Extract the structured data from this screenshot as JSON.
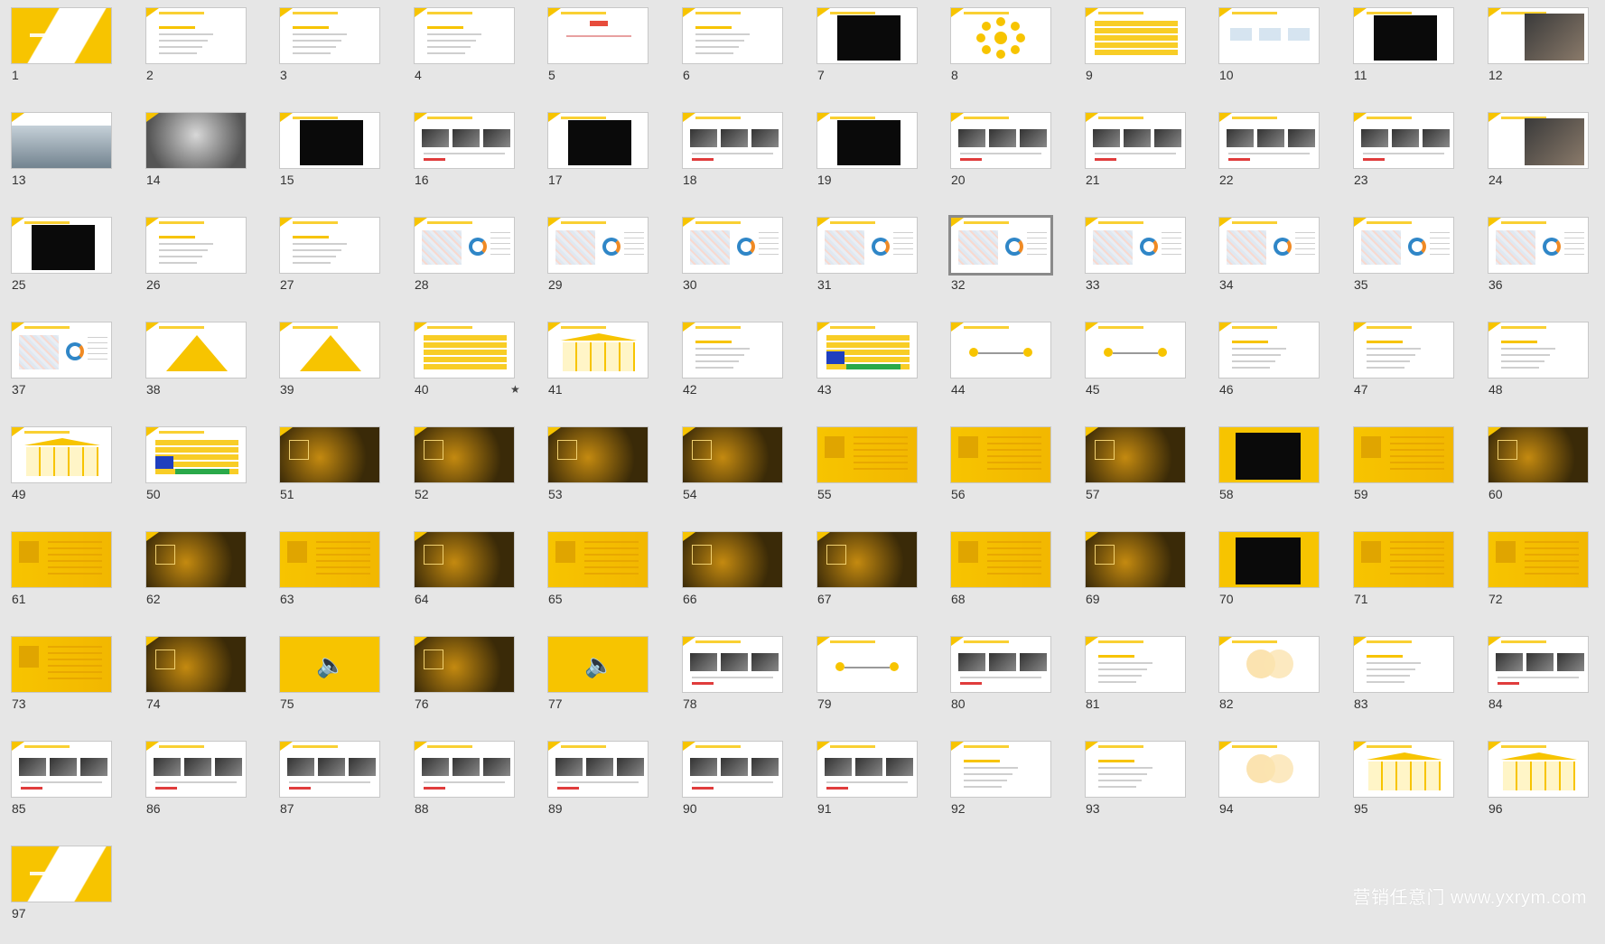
{
  "watermark": "营销任意门 www.yxrym.com",
  "selected_slide": 32,
  "colors": {
    "background": "#e6e6e6",
    "accent": "#f7c400",
    "border": "#c8c8c8"
  },
  "slides": [
    {
      "n": "1",
      "t": "title"
    },
    {
      "n": "2",
      "t": "text"
    },
    {
      "n": "3",
      "t": "text"
    },
    {
      "n": "4",
      "t": "text"
    },
    {
      "n": "5",
      "t": "diagram"
    },
    {
      "n": "6",
      "t": "text"
    },
    {
      "n": "7",
      "t": "video"
    },
    {
      "n": "8",
      "t": "circles"
    },
    {
      "n": "9",
      "t": "table"
    },
    {
      "n": "10",
      "t": "logos"
    },
    {
      "n": "11",
      "t": "video"
    },
    {
      "n": "12",
      "t": "photo"
    },
    {
      "n": "13",
      "t": "sky"
    },
    {
      "n": "14",
      "t": "cloud"
    },
    {
      "n": "15",
      "t": "video"
    },
    {
      "n": "16",
      "t": "mixed"
    },
    {
      "n": "17",
      "t": "video"
    },
    {
      "n": "18",
      "t": "mixed"
    },
    {
      "n": "19",
      "t": "video"
    },
    {
      "n": "20",
      "t": "mixed"
    },
    {
      "n": "21",
      "t": "mixed"
    },
    {
      "n": "22",
      "t": "mixed"
    },
    {
      "n": "23",
      "t": "mixed"
    },
    {
      "n": "24",
      "t": "photo"
    },
    {
      "n": "25",
      "t": "video"
    },
    {
      "n": "26",
      "t": "text"
    },
    {
      "n": "27",
      "t": "text"
    },
    {
      "n": "28",
      "t": "map"
    },
    {
      "n": "29",
      "t": "map"
    },
    {
      "n": "30",
      "t": "map"
    },
    {
      "n": "31",
      "t": "map"
    },
    {
      "n": "32",
      "t": "map"
    },
    {
      "n": "33",
      "t": "map"
    },
    {
      "n": "34",
      "t": "map"
    },
    {
      "n": "35",
      "t": "map"
    },
    {
      "n": "36",
      "t": "map"
    },
    {
      "n": "37",
      "t": "map"
    },
    {
      "n": "38",
      "t": "pyramid"
    },
    {
      "n": "39",
      "t": "pyramid"
    },
    {
      "n": "40",
      "t": "table",
      "star": "★"
    },
    {
      "n": "41",
      "t": "house"
    },
    {
      "n": "42",
      "t": "text"
    },
    {
      "n": "43",
      "t": "grid"
    },
    {
      "n": "44",
      "t": "flow"
    },
    {
      "n": "45",
      "t": "flow"
    },
    {
      "n": "46",
      "t": "text"
    },
    {
      "n": "47",
      "t": "text"
    },
    {
      "n": "48",
      "t": "text"
    },
    {
      "n": "49",
      "t": "house"
    },
    {
      "n": "50",
      "t": "grid"
    },
    {
      "n": "51",
      "t": "dark"
    },
    {
      "n": "52",
      "t": "dark"
    },
    {
      "n": "53",
      "t": "dark"
    },
    {
      "n": "54",
      "t": "dark"
    },
    {
      "n": "55",
      "t": "yellow"
    },
    {
      "n": "56",
      "t": "yellow"
    },
    {
      "n": "57",
      "t": "dark"
    },
    {
      "n": "58",
      "t": "yellowvideo"
    },
    {
      "n": "59",
      "t": "yellow"
    },
    {
      "n": "60",
      "t": "dark"
    },
    {
      "n": "61",
      "t": "yellow"
    },
    {
      "n": "62",
      "t": "dark"
    },
    {
      "n": "63",
      "t": "yellow"
    },
    {
      "n": "64",
      "t": "dark"
    },
    {
      "n": "65",
      "t": "yellow"
    },
    {
      "n": "66",
      "t": "dark"
    },
    {
      "n": "67",
      "t": "dark"
    },
    {
      "n": "68",
      "t": "yellow"
    },
    {
      "n": "69",
      "t": "dark"
    },
    {
      "n": "70",
      "t": "yellowvideo"
    },
    {
      "n": "71",
      "t": "yellow"
    },
    {
      "n": "72",
      "t": "yellow"
    },
    {
      "n": "73",
      "t": "yellow"
    },
    {
      "n": "74",
      "t": "dark"
    },
    {
      "n": "75",
      "t": "audio"
    },
    {
      "n": "76",
      "t": "dark"
    },
    {
      "n": "77",
      "t": "audio"
    },
    {
      "n": "78",
      "t": "mixed"
    },
    {
      "n": "79",
      "t": "flow"
    },
    {
      "n": "80",
      "t": "mixed"
    },
    {
      "n": "81",
      "t": "text"
    },
    {
      "n": "82",
      "t": "venn"
    },
    {
      "n": "83",
      "t": "text"
    },
    {
      "n": "84",
      "t": "mixed"
    },
    {
      "n": "85",
      "t": "mixed"
    },
    {
      "n": "86",
      "t": "mixed"
    },
    {
      "n": "87",
      "t": "mixed"
    },
    {
      "n": "88",
      "t": "mixed"
    },
    {
      "n": "89",
      "t": "mixed"
    },
    {
      "n": "90",
      "t": "mixed"
    },
    {
      "n": "91",
      "t": "mixed"
    },
    {
      "n": "92",
      "t": "text"
    },
    {
      "n": "93",
      "t": "text"
    },
    {
      "n": "94",
      "t": "venn"
    },
    {
      "n": "95",
      "t": "house"
    },
    {
      "n": "96",
      "t": "house"
    },
    {
      "n": "97",
      "t": "end"
    }
  ]
}
